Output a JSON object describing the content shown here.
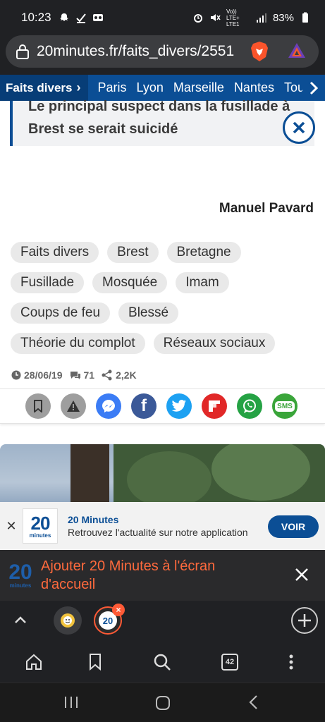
{
  "status": {
    "time": "10:23",
    "network": "Vo)) LTE+ LTE1",
    "battery": "83%"
  },
  "browser": {
    "url": "20minutes.fr/faits_divers/2551",
    "tab_count": "42"
  },
  "nav": {
    "active": "Faits divers",
    "items": [
      "Paris",
      "Lyon",
      "Marseille",
      "Nantes",
      "Tou"
    ]
  },
  "quote": {
    "text": "Le principal suspect dans la fusillade à Brest se serait suicidé"
  },
  "article": {
    "author": "Manuel Pavard",
    "date": "28/06/19",
    "comments": "71",
    "shares": "2,2K"
  },
  "tags": [
    [
      "Faits divers",
      "Brest",
      "Bretagne"
    ],
    [
      "Fusillade",
      "Mosquée",
      "Imam"
    ],
    [
      "Coups de feu",
      "Blessé"
    ],
    [
      "Théorie du complot",
      "Réseaux sociaux"
    ]
  ],
  "share_buttons": [
    {
      "name": "bookmark",
      "color": "#9e9e9e"
    },
    {
      "name": "report",
      "color": "#9e9e9e"
    },
    {
      "name": "messenger",
      "color": "#3b7cf5"
    },
    {
      "name": "facebook",
      "color": "#3b5998"
    },
    {
      "name": "twitter",
      "color": "#1da1f2"
    },
    {
      "name": "flipboard",
      "color": "#e12828"
    },
    {
      "name": "whatsapp",
      "color": "#25a244"
    },
    {
      "name": "sms",
      "color": "#3aa53a"
    }
  ],
  "sms_label": "SMS",
  "app_banner": {
    "logo_number": "20",
    "logo_word": "minutes",
    "title": "20 Minutes",
    "subtitle": "Retrouvez l'actualité sur notre application",
    "button": "VOIR",
    "close": "✕"
  },
  "add_home": {
    "text": "Ajouter 20 Minutes à l'écran d'accueil"
  },
  "colors": {
    "brand_blue": "#0b4e95",
    "accent_orange": "#ff5a36"
  }
}
